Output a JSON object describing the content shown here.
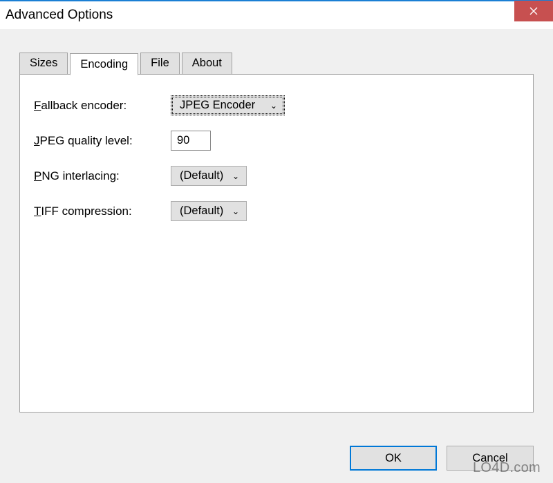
{
  "window": {
    "title": "Advanced Options"
  },
  "tabs": {
    "sizes": "Sizes",
    "encoding": "Encoding",
    "file": "File",
    "about": "About"
  },
  "form": {
    "fallback_label": "Fallback encoder:",
    "fallback_value": "JPEG Encoder",
    "jpeg_label": "JPEG quality level:",
    "jpeg_value": "90",
    "png_label": "PNG interlacing:",
    "png_value": "(Default)",
    "tiff_label": "TIFF compression:",
    "tiff_value": "(Default)"
  },
  "buttons": {
    "ok": "OK",
    "cancel": "Cancel"
  },
  "watermark": "LO4D.com"
}
